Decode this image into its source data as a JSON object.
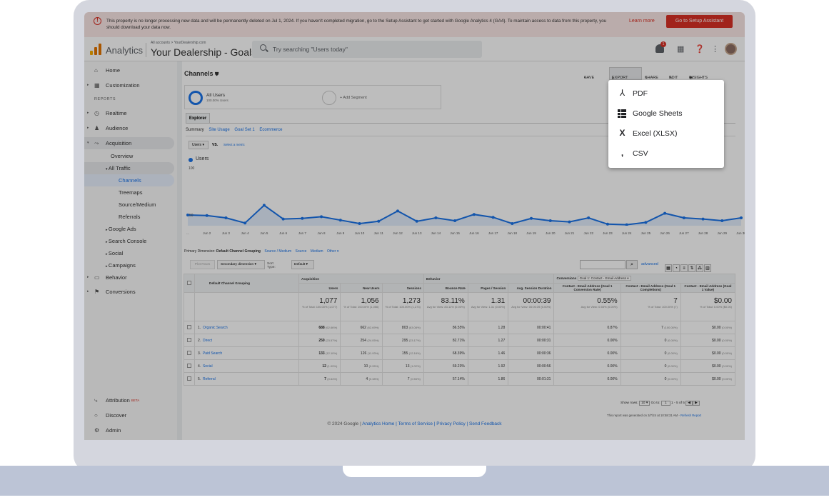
{
  "banner": {
    "text": "This property is no longer processing new data and will be permanently deleted on Jul 1, 2024. If you haven't completed migration, go to the Setup Assistant to get started with Google Analytics 4 (GA4). To maintain access to data from this property, you should download your data now.",
    "learn_more": "Learn more",
    "setup_button": "Go to Setup Assistant"
  },
  "header": {
    "app_name": "Analytics",
    "account_path": "All accounts > YourDealership.com",
    "property_name": "Your Dealership - Goals",
    "search_placeholder": "Try searching \"Users today\"",
    "notification_count": "1"
  },
  "sidebar": {
    "home": "Home",
    "customization": "Customization",
    "reports_heading": "REPORTS",
    "realtime": "Realtime",
    "audience": "Audience",
    "acquisition": "Acquisition",
    "overview": "Overview",
    "all_traffic": "All Traffic",
    "channels": "Channels",
    "treemaps": "Treemaps",
    "source_medium": "Source/Medium",
    "referrals": "Referrals",
    "google_ads": "Google Ads",
    "search_console": "Search Console",
    "social": "Social",
    "campaigns": "Campaigns",
    "behavior": "Behavior",
    "conversions": "Conversions",
    "attribution": "Attribution",
    "beta": "BETA",
    "discover": "Discover",
    "admin": "Admin"
  },
  "report": {
    "title": "Channels",
    "toolbar": {
      "save": "SAVE",
      "export": "EXPORT",
      "share": "SHARE",
      "edit": "EDIT",
      "insights": "INSIGHTS"
    },
    "segment_name": "All Users",
    "segment_sub": "100.00% Users",
    "add_segment": "+ Add Segment",
    "explorer_tab": "Explorer",
    "subtabs": [
      "Summary",
      "Site Usage",
      "Goal Set 1",
      "Ecommerce"
    ],
    "metric_select": "Users",
    "vs": "VS.",
    "select_metric": "Select a metric",
    "legend": "Users",
    "y_max_label": "100",
    "y_mid_label": "50",
    "primary_dimension_label": "Primary Dimension:",
    "primary_dimension_value": "Default Channel Grouping",
    "dimension_links": [
      "Source / Medium",
      "Source",
      "Medium",
      "Other"
    ],
    "plot_rows": "Plot Rows",
    "secondary_dimension": "Secondary dimension",
    "sort_type_label": "Sort Type:",
    "sort_type": "Default",
    "advanced": "advanced",
    "conversions_label": "Conversions",
    "goal_select": "Goal 1: Contact - Email Address"
  },
  "chart_data": {
    "type": "line",
    "title": "",
    "xlabel": "",
    "ylabel": "",
    "x": [
      "...",
      "Jun 2",
      "Jun 3",
      "Jun 4",
      "Jun 5",
      "Jun 6",
      "Jun 7",
      "Jun 8",
      "Jun 9",
      "Jun 10",
      "Jun 11",
      "Jun 12",
      "Jun 13",
      "Jun 14",
      "Jun 15",
      "Jun 16",
      "Jun 17",
      "Jun 18",
      "Jun 19",
      "Jun 20",
      "Jun 21",
      "Jun 22",
      "Jun 23",
      "Jun 24",
      "Jun 25",
      "Jun 26",
      "Jun 27",
      "Jun 28",
      "Jun 29",
      "Jun 30"
    ],
    "series": [
      {
        "name": "Users",
        "values": [
          50,
          49,
          45,
          36,
          67,
          43,
          44,
          47,
          41,
          35,
          39,
          57,
          39,
          45,
          40,
          51,
          46,
          35,
          44,
          40,
          38,
          45,
          34,
          33,
          37,
          53,
          45,
          43,
          40,
          45
        ]
      }
    ],
    "ylim": [
      0,
      100
    ],
    "grid": false,
    "legend": "top-left"
  },
  "table": {
    "dimension_header": "Default Channel Grouping",
    "group_acquisition": "Acquisition",
    "group_behavior": "Behavior",
    "headers": [
      "Users",
      "New Users",
      "Sessions",
      "Bounce Rate",
      "Pages / Session",
      "Avg. Session Duration",
      "Contact - Email Address (Goal 1 Conversion Rate)",
      "Contact - Email Address (Goal 1 Completions)",
      "Contact - Email Address (Goal 1 Value)"
    ],
    "totals": [
      {
        "value": "1,077",
        "sub": "% of Total: 100.00% (1,077)"
      },
      {
        "value": "1,056",
        "sub": "% of Total: 100.00% (1,056)"
      },
      {
        "value": "1,273",
        "sub": "% of Total: 100.00% (1,273)"
      },
      {
        "value": "83.11%",
        "sub": "Avg for View: 83.11% (0.00%)"
      },
      {
        "value": "1.31",
        "sub": "Avg for View: 1.31 (0.00%)"
      },
      {
        "value": "00:00:39",
        "sub": "Avg for View: 00:00:39 (0.00%)"
      },
      {
        "value": "0.55%",
        "sub": "Avg for View: 0.55% (0.00%)"
      },
      {
        "value": "7",
        "sub": "% of Total: 100.00% (7)"
      },
      {
        "value": "$0.00",
        "sub": "% of Total: 0.00% ($0.00)"
      }
    ],
    "rows": [
      {
        "idx": "1.",
        "name": "Organic Search",
        "users": "688",
        "users_pct": "(62.66%)",
        "new_users": "662",
        "new_users_pct": "(62.69%)",
        "sessions": "803",
        "sessions_pct": "(63.08%)",
        "bounce": "86.55%",
        "pages": "1.28",
        "duration": "00:00:41",
        "conv_rate": "0.87%",
        "completions": "7",
        "completions_pct": "(100.00%)",
        "value": "$0.00",
        "value_pct": "(0.00%)"
      },
      {
        "idx": "2.",
        "name": "Direct",
        "users": "259",
        "users_pct": "(23.57%)",
        "new_users": "254",
        "new_users_pct": "(24.05%)",
        "sessions": "295",
        "sessions_pct": "(23.17%)",
        "bounce": "82.71%",
        "pages": "1.27",
        "duration": "00:00:31",
        "conv_rate": "0.00%",
        "completions": "0",
        "completions_pct": "(0.00%)",
        "value": "$0.00",
        "value_pct": "(0.00%)"
      },
      {
        "idx": "3.",
        "name": "Paid Search",
        "users": "133",
        "users_pct": "(12.10%)",
        "new_users": "126",
        "new_users_pct": "(11.93%)",
        "sessions": "155",
        "sessions_pct": "(12.18%)",
        "bounce": "68.39%",
        "pages": "1.46",
        "duration": "00:00:36",
        "conv_rate": "0.00%",
        "completions": "0",
        "completions_pct": "(0.00%)",
        "value": "$0.00",
        "value_pct": "(0.00%)"
      },
      {
        "idx": "4.",
        "name": "Social",
        "users": "12",
        "users_pct": "(1.09%)",
        "new_users": "10",
        "new_users_pct": "(0.95%)",
        "sessions": "13",
        "sessions_pct": "(1.02%)",
        "bounce": "69.23%",
        "pages": "1.92",
        "duration": "00:00:56",
        "conv_rate": "0.00%",
        "completions": "0",
        "completions_pct": "(0.00%)",
        "value": "$0.00",
        "value_pct": "(0.00%)"
      },
      {
        "idx": "5.",
        "name": "Referral",
        "users": "7",
        "users_pct": "(0.64%)",
        "new_users": "4",
        "new_users_pct": "(0.38%)",
        "sessions": "7",
        "sessions_pct": "(0.55%)",
        "bounce": "57.14%",
        "pages": "1.86",
        "duration": "00:01:31",
        "conv_rate": "0.00%",
        "completions": "0",
        "completions_pct": "(0.00%)",
        "value": "$0.00",
        "value_pct": "(0.00%)"
      }
    ],
    "show_rows_label": "Show rows:",
    "show_rows_value": "10",
    "goto_label": "Go to:",
    "goto_value": "1",
    "range": "1 - 5 of 5",
    "generated": "This report was generated on 3/7/24 at 10:58:31 AM -",
    "refresh": "Refresh Report"
  },
  "footer": {
    "copyright": "© 2024 Google |",
    "links": "Analytics Home | Terms of Service | Privacy Policy | Send Feedback"
  },
  "export_menu": {
    "items": [
      {
        "label": "PDF",
        "icon": "pdf-icon"
      },
      {
        "label": "Google Sheets",
        "icon": "sheets-icon"
      },
      {
        "label": "Excel (XLSX)",
        "icon": "excel-icon"
      },
      {
        "label": "CSV",
        "icon": "csv-icon"
      }
    ]
  },
  "colors": {
    "accent": "#1a73e8",
    "alert": "#d93025",
    "laptop_frame": "#d4d6de",
    "laptop_base": "#bcc4d6"
  }
}
